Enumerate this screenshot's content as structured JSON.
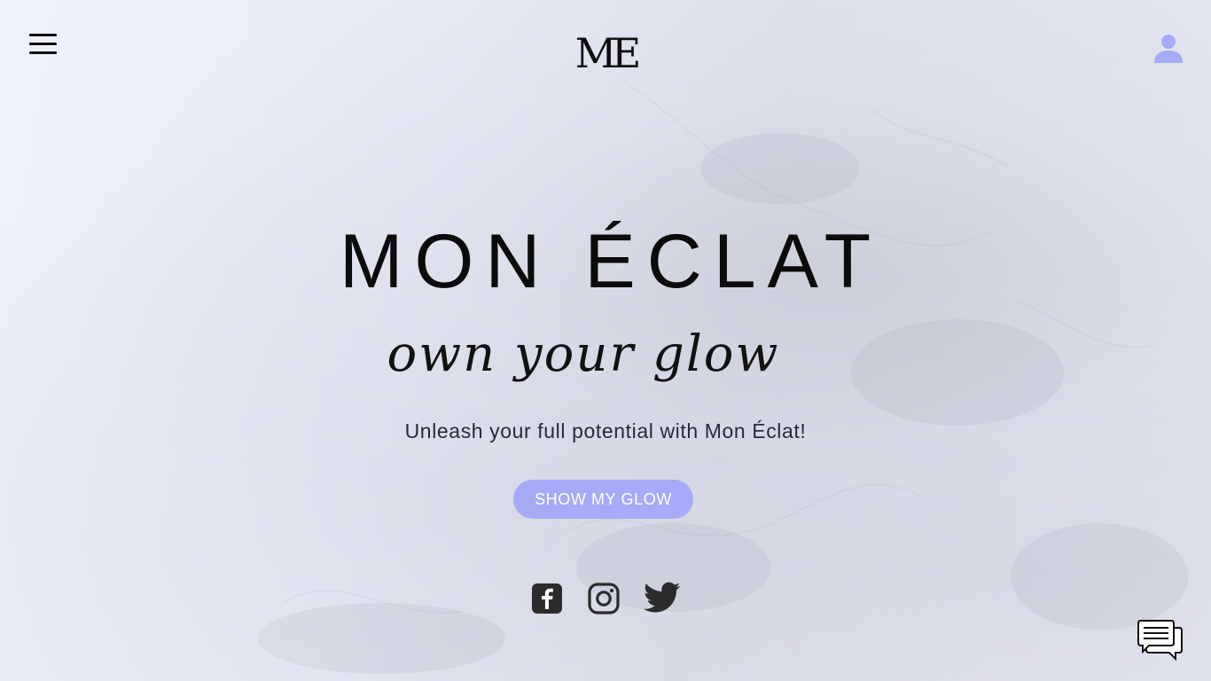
{
  "header": {
    "logo_text": "ME",
    "menu_icon": "hamburger-menu-icon",
    "account_icon": "user-icon"
  },
  "hero": {
    "title": "MON ÉCLAT",
    "tagline": "own your glow",
    "subtitle": "Unleash your full potential with Mon Éclat!",
    "cta_label": "SHOW MY GLOW"
  },
  "social": {
    "icons": [
      "facebook-icon",
      "instagram-icon",
      "twitter-icon"
    ]
  },
  "chat": {
    "icon": "chat-bubbles-icon"
  },
  "colors": {
    "accent": "#a6aaf7",
    "icon_dark": "#2b2b2b",
    "text": "#111111"
  }
}
